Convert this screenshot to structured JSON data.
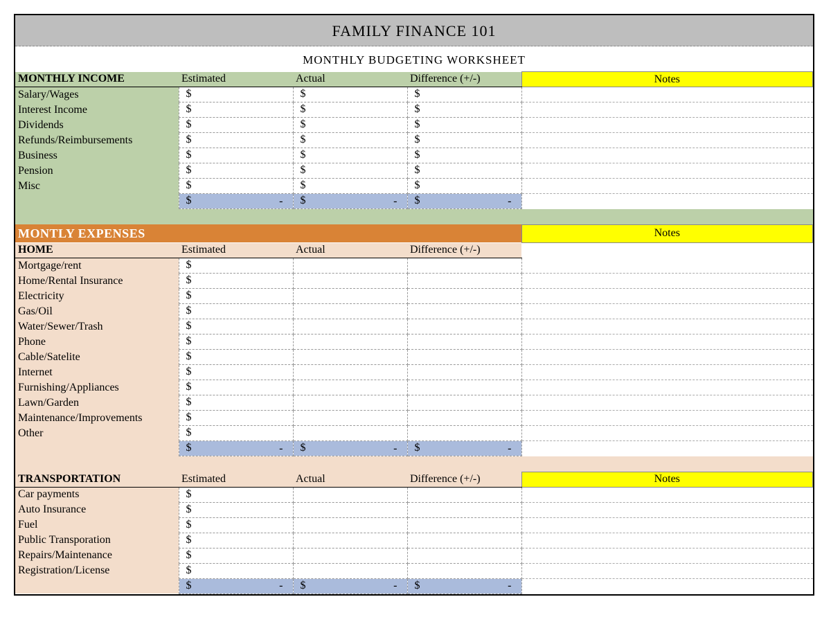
{
  "title": "FAMILY FINANCE 101",
  "subtitle": "MONTHLY BUDGETING WORKSHEET",
  "cols": {
    "est": "Estimated",
    "act": "Actual",
    "diff": "Difference (+/-)",
    "notes": "Notes"
  },
  "income": {
    "head": "MONTHLY INCOME",
    "rows": [
      "Salary/Wages",
      "Interest Income",
      "Dividends",
      "Refunds/Reimbursements",
      "Business",
      "Pension",
      "Misc"
    ]
  },
  "expensesTitle": "MONTLY EXPENSES",
  "home": {
    "head": "HOME",
    "rows": [
      "Mortgage/rent",
      "Home/Rental Insurance",
      "Electricity",
      "Gas/Oil",
      "Water/Sewer/Trash",
      "Phone",
      "Cable/Satelite",
      "Internet",
      "Furnishing/Appliances",
      "Lawn/Garden",
      "Maintenance/Improvements",
      "Other"
    ]
  },
  "transport": {
    "head": "TRANSPORTATION",
    "rows": [
      "Car payments",
      "Auto Insurance",
      "Fuel",
      "Public Transporation",
      "Repairs/Maintenance",
      "Registration/License"
    ]
  }
}
